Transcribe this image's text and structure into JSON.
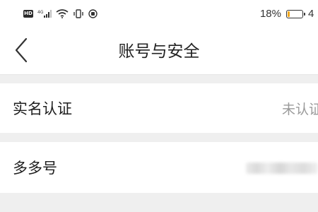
{
  "status_bar": {
    "hd_label": "HD",
    "network_label": "4G",
    "battery_percent": "18%",
    "battery_level": 0.18,
    "time_partial": "4"
  },
  "nav": {
    "title": "账号与安全"
  },
  "rows": [
    {
      "label": "实名认证",
      "value": "未认证"
    },
    {
      "label": "多多号"
    }
  ],
  "colors": {
    "battery_fill": "#f2a71b",
    "page_background": "#efefef",
    "value_text": "#9a9a9a"
  }
}
